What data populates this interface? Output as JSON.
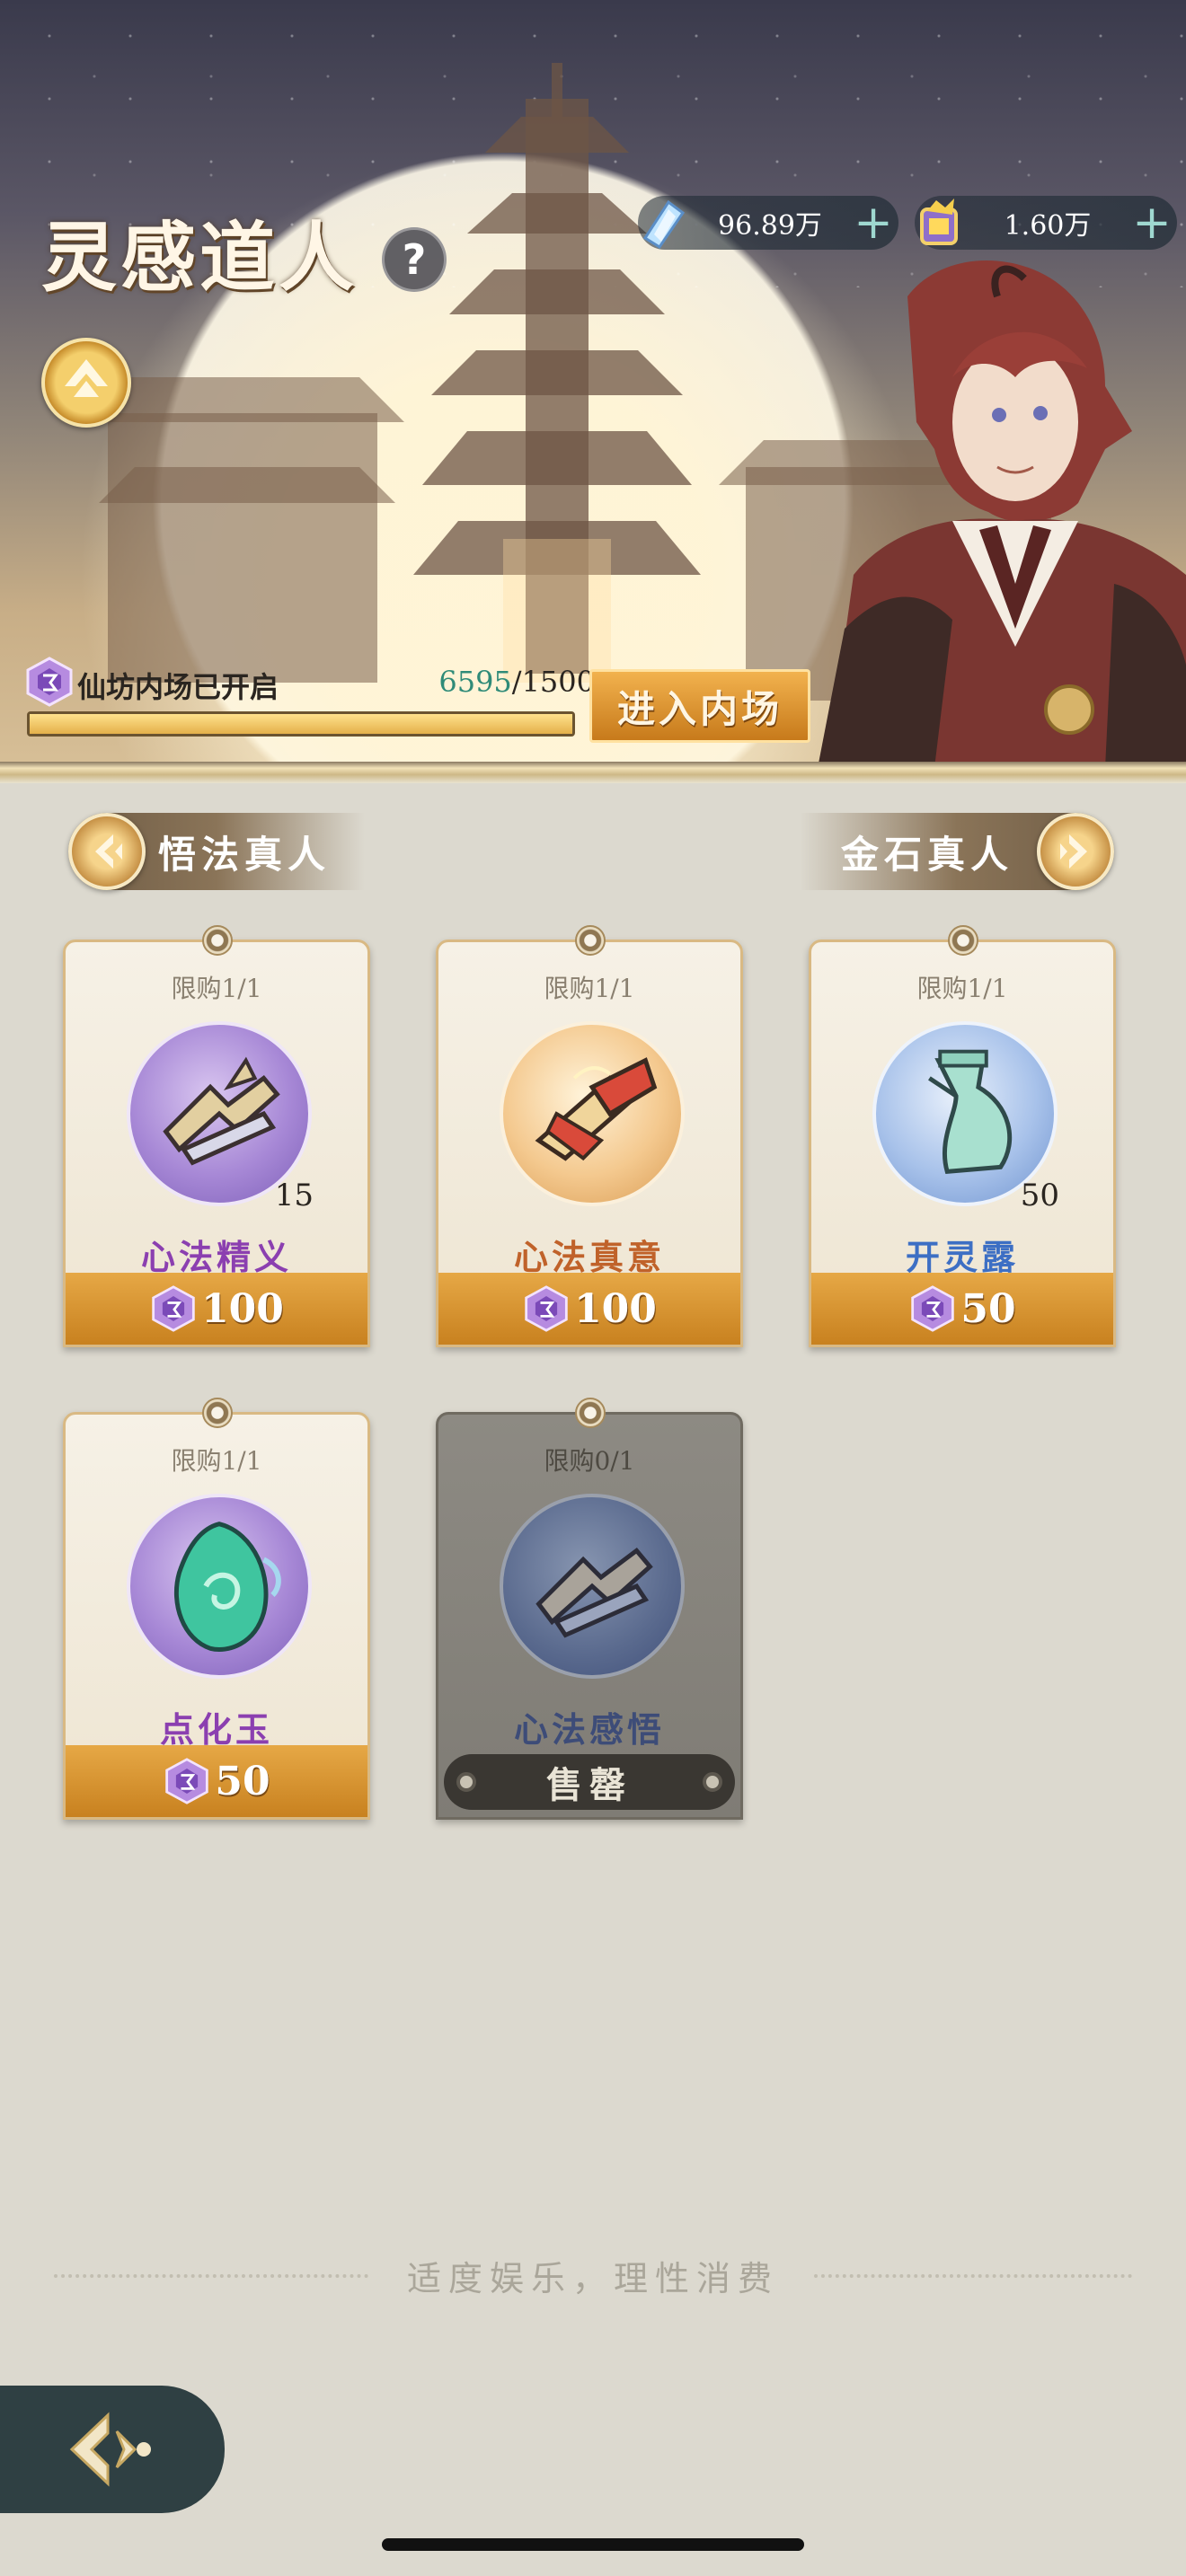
{
  "header": {
    "title": "灵感道人",
    "help_label": "?",
    "currencies": [
      {
        "icon": "crystal-currency-icon",
        "value": "96.89万",
        "add_label": "+"
      },
      {
        "icon": "gold-currency-icon",
        "value": "1.60万",
        "add_label": "+"
      }
    ]
  },
  "unlock": {
    "label": "仙坊内场已开启",
    "current": "6595",
    "separator_total": "/1500",
    "progress_fraction": 1.0,
    "enter_button": "进入内场"
  },
  "nav": {
    "prev_label": "悟法真人",
    "next_label": "金石真人"
  },
  "items": [
    {
      "limit": "限购1/1",
      "name": "心法精义",
      "qty": "15",
      "price": "100",
      "theme": "purple",
      "icon": "broken-scroll-icon"
    },
    {
      "limit": "限购1/1",
      "name": "心法真意",
      "qty": "",
      "price": "100",
      "theme": "orange",
      "icon": "golden-scroll-icon"
    },
    {
      "limit": "限购1/1",
      "name": "开灵露",
      "qty": "50",
      "price": "50",
      "theme": "blue",
      "icon": "jade-gourd-icon"
    },
    {
      "limit": "限购1/1",
      "name": "点化玉",
      "qty": "",
      "price": "50",
      "theme": "purple",
      "icon": "jade-stone-icon"
    },
    {
      "limit": "限购0/1",
      "name": "心法感悟",
      "qty": "",
      "status": "售罄",
      "theme": "soldout",
      "icon": "blue-scroll-icon"
    }
  ],
  "footer": {
    "note": "适度娱乐，理性消费"
  },
  "colors": {
    "accent_gold": "#d89a3a",
    "progress_current": "#2f8b78",
    "purple_name": "#8b3fb0",
    "orange_name": "#c0622a",
    "blue_name": "#3d6fc4"
  }
}
